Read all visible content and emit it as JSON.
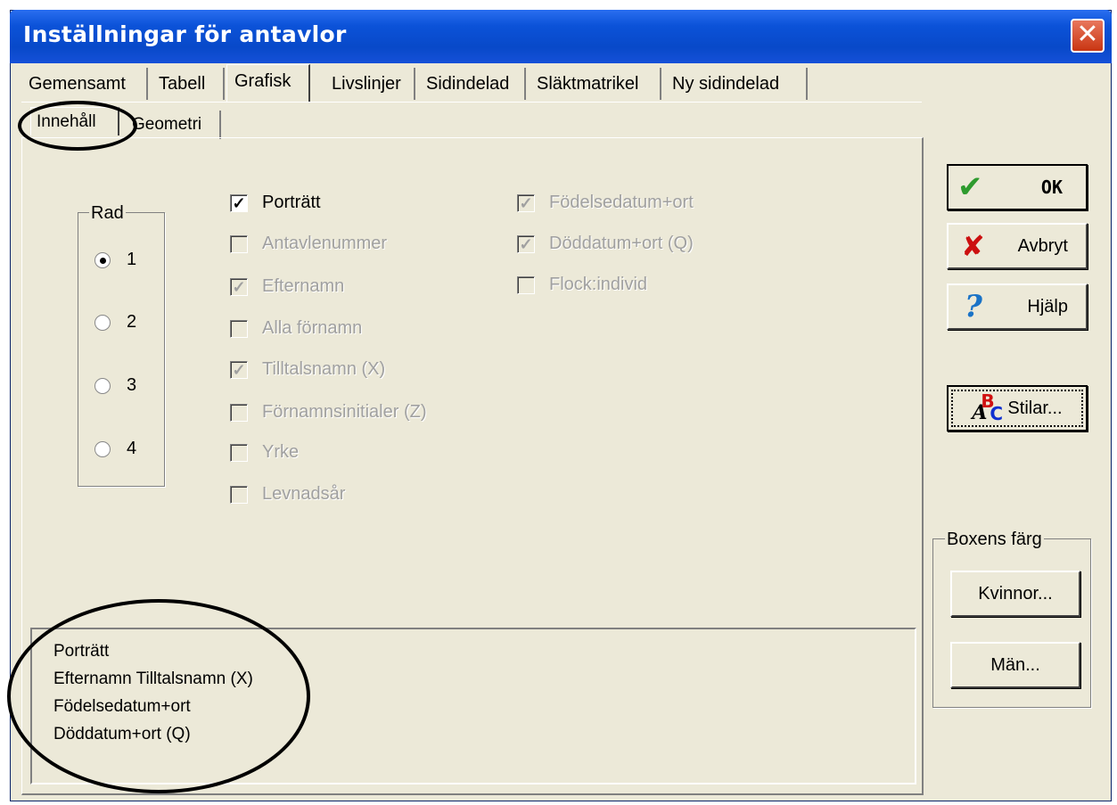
{
  "window": {
    "title": "Inställningar för antavlor",
    "close_label": "✕"
  },
  "tabs": [
    {
      "label": "Gemensamt",
      "active": false
    },
    {
      "label": "Tabell",
      "active": false
    },
    {
      "label": "Grafisk",
      "active": true
    },
    {
      "label": "Livslinjer",
      "active": false
    },
    {
      "label": "Sidindelad",
      "active": false
    },
    {
      "label": "Släktmatrikel",
      "active": false
    },
    {
      "label": "Ny sidindelad",
      "active": false
    }
  ],
  "subtabs": [
    {
      "label": "Innehåll",
      "active": true
    },
    {
      "label": "Geometri",
      "active": false
    }
  ],
  "rad": {
    "legend": "Rad",
    "options": [
      {
        "label": "1",
        "checked": true
      },
      {
        "label": "2",
        "checked": false
      },
      {
        "label": "3",
        "checked": false
      },
      {
        "label": "4",
        "checked": false
      }
    ]
  },
  "checkboxes_left": [
    {
      "label": "Porträtt",
      "checked": true,
      "enabled": true
    },
    {
      "label": "Antavlenummer",
      "checked": false,
      "enabled": false
    },
    {
      "label": "Efternamn",
      "checked": true,
      "enabled": false
    },
    {
      "label": "Alla förnamn",
      "checked": false,
      "enabled": false
    },
    {
      "label": "Tilltalsnamn (X)",
      "checked": true,
      "enabled": false
    },
    {
      "label": "Förnamnsinitialer (Z)",
      "checked": false,
      "enabled": false
    },
    {
      "label": "Yrke",
      "checked": false,
      "enabled": false
    },
    {
      "label": "Levnadsår",
      "checked": false,
      "enabled": false
    }
  ],
  "checkboxes_right": [
    {
      "label": "Födelsedatum+ort",
      "checked": true,
      "enabled": false
    },
    {
      "label": "Döddatum+ort (Q)",
      "checked": true,
      "enabled": false
    },
    {
      "label": "Flock:individ",
      "checked": false,
      "enabled": false
    }
  ],
  "buttons": {
    "ok": "OK",
    "cancel": "Avbryt",
    "help": "Hjälp",
    "styles": "Stilar..."
  },
  "box_color": {
    "legend": "Boxens färg",
    "women": "Kvinnor...",
    "men": "Män..."
  },
  "preview_lines": [
    "Porträtt",
    "Efternamn Tilltalsnamn (X)",
    "Födelsedatum+ort",
    "Döddatum+ort (Q)"
  ],
  "colors": {
    "titlebar": "#0b52d8",
    "face": "#ece9d8",
    "ok_check": "#2e9b2e",
    "cancel_x": "#cc1010",
    "help_q": "#1a73c7"
  }
}
